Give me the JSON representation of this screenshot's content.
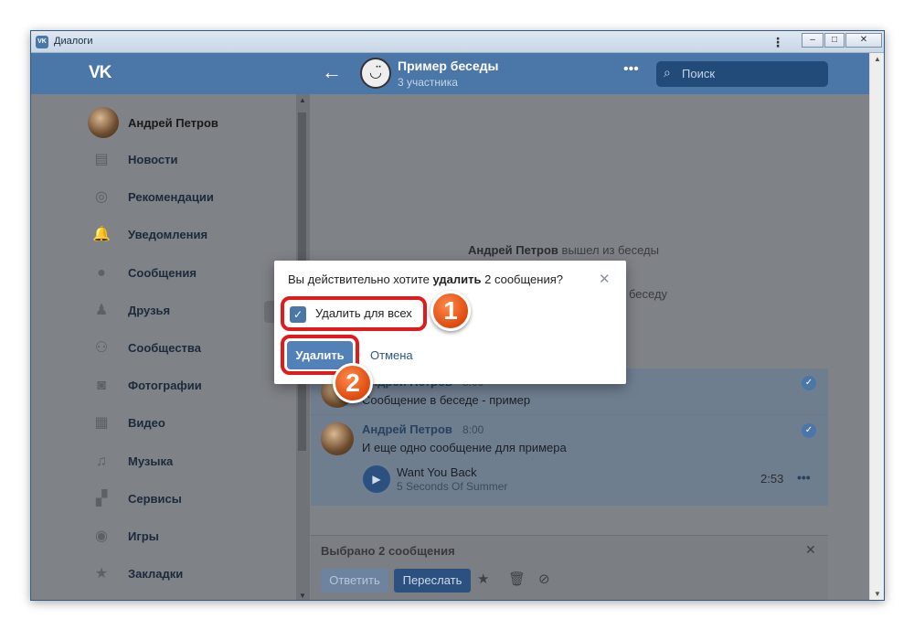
{
  "window": {
    "title": "Диалоги",
    "app_icon": "VK",
    "controls": {
      "kebab": "⋮",
      "minimize": "–",
      "maximize": "□",
      "close": "✕"
    }
  },
  "header": {
    "logo": "VK",
    "back_icon": "←",
    "conversation_title": "Пример беседы",
    "conversation_subtitle": "3 участника",
    "more_icon": "•••",
    "search_placeholder": "Поиск"
  },
  "sidebar": {
    "profile_name": "Андрей Петров",
    "items": [
      {
        "label": "Новости",
        "icon": "news-icon",
        "glyph": "▤"
      },
      {
        "label": "Рекомендации",
        "icon": "compass-icon",
        "glyph": "◎"
      },
      {
        "label": "Уведомления",
        "icon": "bell-icon",
        "glyph": "🔔"
      },
      {
        "label": "Сообщения",
        "icon": "chat-bubble-icon",
        "glyph": "●"
      },
      {
        "label": "Друзья",
        "icon": "person-icon",
        "glyph": "♟"
      },
      {
        "label": "Сообщества",
        "icon": "people-icon",
        "glyph": "⚇"
      },
      {
        "label": "Фотографии",
        "icon": "camera-icon",
        "glyph": "◙"
      },
      {
        "label": "Видео",
        "icon": "film-icon",
        "glyph": "▦"
      },
      {
        "label": "Музыка",
        "icon": "music-note-icon",
        "glyph": "♫"
      },
      {
        "label": "Сервисы",
        "icon": "grid-icon",
        "glyph": "▞"
      },
      {
        "label": "Игры",
        "icon": "gamepad-icon",
        "glyph": "◉"
      },
      {
        "label": "Закладки",
        "icon": "star-icon",
        "glyph": "★"
      }
    ]
  },
  "chat": {
    "system_left_author": "Андрей Петров",
    "system_left_text": " вышел из беседы",
    "system_partial": "беседу",
    "messages": [
      {
        "author": "Андрей Петров",
        "time": "8:00",
        "text": "Сообщение в беседе - пример",
        "selected": true
      },
      {
        "author": "Андрей Петров",
        "time": "8:00",
        "text": "И еще одно сообщение для примера",
        "selected": true
      }
    ],
    "audio": {
      "title": "Want You Back",
      "artist": "5 Seconds Of Summer",
      "duration": "2:53"
    },
    "selection": {
      "count_text": "Выбрано 2 сообщения",
      "reply_label": "Ответить",
      "forward_label": "Переслать"
    }
  },
  "dialog": {
    "question_prefix": "Вы действительно хотите ",
    "question_bold": "удалить",
    "question_suffix": " 2 сообщения?",
    "checkbox_label": "Удалить для всех",
    "checkbox_checked": true,
    "delete_label": "Удалить",
    "cancel_label": "Отмена"
  },
  "annotations": {
    "step1": "1",
    "step2": "2",
    "highlight_color": "#e01b1b",
    "badge_color": "#e04e12"
  },
  "colors": {
    "vk_blue": "#4a76a8",
    "button_blue": "#5181b8",
    "link_blue": "#2a5885"
  }
}
